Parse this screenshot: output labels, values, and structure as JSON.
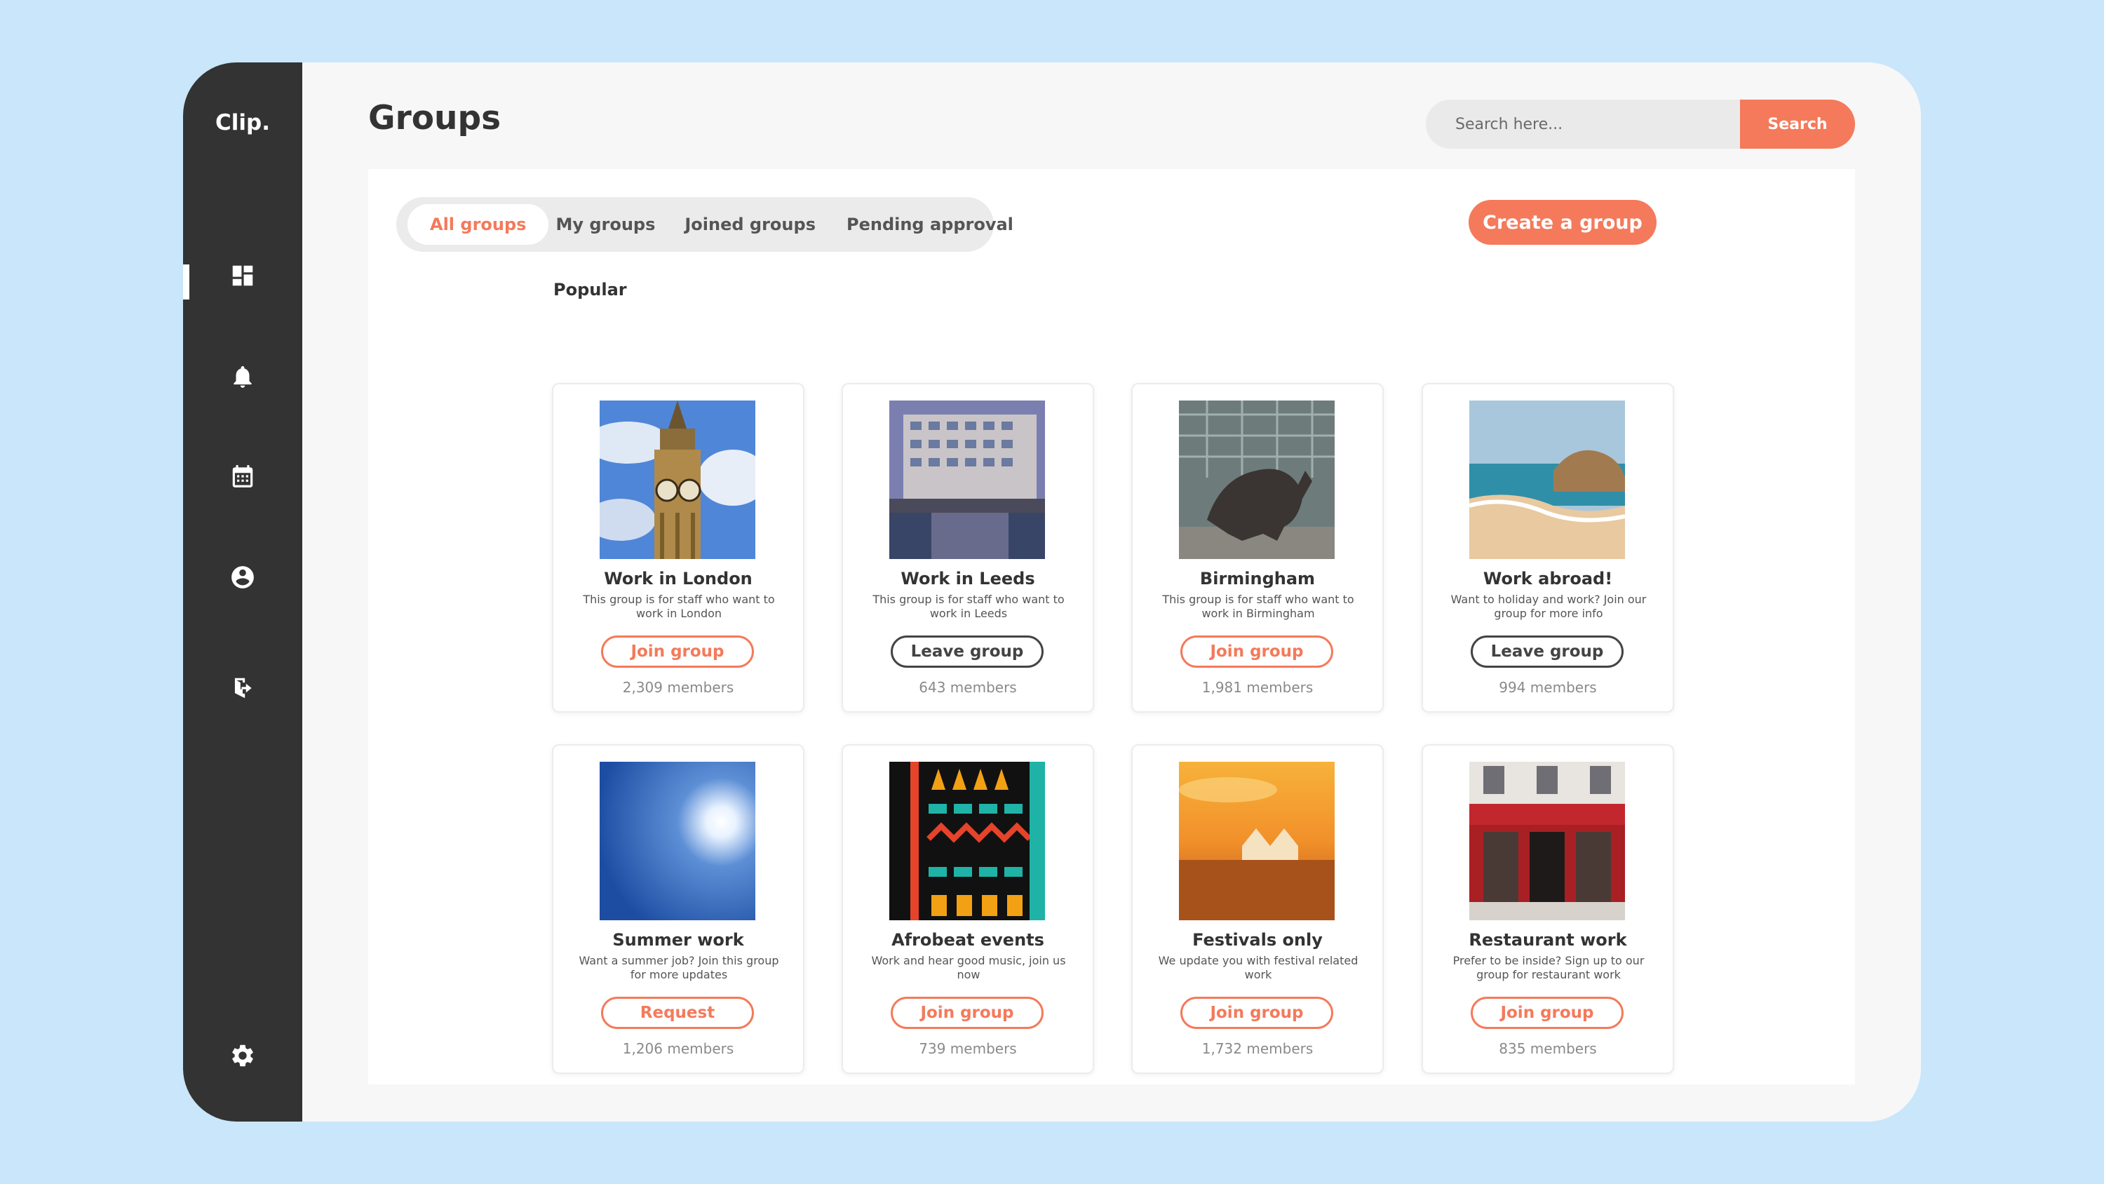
{
  "app": {
    "logo": "Clip."
  },
  "sidebar": {
    "items": [
      {
        "icon": "dashboard-icon",
        "active": true
      },
      {
        "icon": "bell-icon",
        "active": false
      },
      {
        "icon": "calendar-icon",
        "active": false
      },
      {
        "icon": "account-icon",
        "active": false
      },
      {
        "icon": "logout-icon",
        "active": false
      },
      {
        "icon": "gear-icon",
        "active": false
      }
    ]
  },
  "header": {
    "title": "Groups",
    "search_placeholder": "Search here...",
    "search_label": "Search"
  },
  "tabs": [
    {
      "label": "All groups",
      "active": true
    },
    {
      "label": "My groups",
      "active": false
    },
    {
      "label": "Joined groups",
      "active": false
    },
    {
      "label": "Pending approval",
      "active": false
    }
  ],
  "create_label": "Create a group",
  "section_label": "Popular",
  "groups": [
    {
      "title": "Work in London",
      "desc": "This group is for staff who want to work in London",
      "action": "Join group",
      "style": "orange",
      "members": "2,309 members",
      "image": "clock-tower"
    },
    {
      "title": "Work in Leeds",
      "desc": "This group is for staff who want to work in Leeds",
      "action": "Leave group",
      "style": "dark",
      "members": "643 members",
      "image": "waterfront-apartments"
    },
    {
      "title": "Birmingham",
      "desc": "This group is for staff who want to work in Birmingham",
      "action": "Join group",
      "style": "orange",
      "members": "1,981 members",
      "image": "bull-statue"
    },
    {
      "title": "Work abroad!",
      "desc": "Want to holiday and work? Join our group for more info",
      "action": "Leave group",
      "style": "dark",
      "members": "994 members",
      "image": "beach"
    },
    {
      "title": "Summer work",
      "desc": "Want a summer job? Join this group for more updates",
      "action": "Request",
      "style": "orange",
      "members": "1,206 members",
      "image": "sun-sky"
    },
    {
      "title": "Afrobeat events",
      "desc": "Work and hear good music, join us now",
      "action": "Join group",
      "style": "orange",
      "members": "739 members",
      "image": "african-pattern"
    },
    {
      "title": "Festivals only",
      "desc": "We update you with festival related work",
      "action": "Join group",
      "style": "orange",
      "members": "1,732 members",
      "image": "festival-crowd"
    },
    {
      "title": "Restaurant work",
      "desc": "Prefer to be inside? Sign up to our group for restaurant work",
      "action": "Join group",
      "style": "orange",
      "members": "835 members",
      "image": "restaurant-front"
    }
  ],
  "colors": {
    "accent": "#f47a5b",
    "sidebar": "#333333",
    "background": "#c9e6fb"
  }
}
